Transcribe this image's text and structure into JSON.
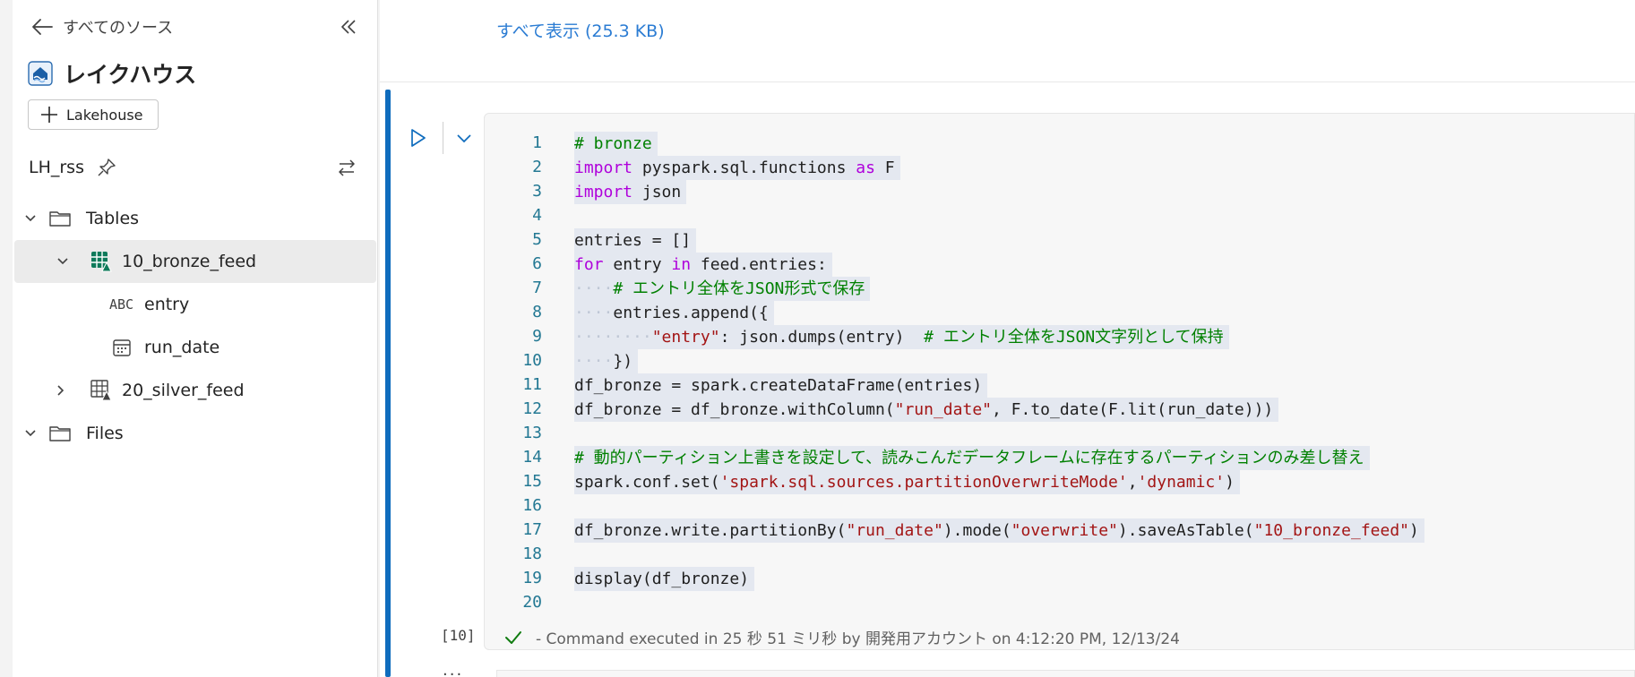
{
  "sidebar": {
    "back_label": "すべてのソース",
    "title": "レイクハウス",
    "add_button_label": "Lakehouse",
    "lakehouse_name": "LH_rss",
    "tree": {
      "tables_label": "Tables",
      "table1": "10_bronze_feed",
      "column1_type": "ABC",
      "column1": "entry",
      "column2": "run_date",
      "table2": "20_silver_feed",
      "files_label": "Files"
    }
  },
  "notebook": {
    "show_all_label": "すべて表示 (25.3 KB)",
    "line_numbers": [
      "1",
      "2",
      "3",
      "4",
      "5",
      "6",
      "7",
      "8",
      "9",
      "10",
      "11",
      "12",
      "13",
      "14",
      "15",
      "16",
      "17",
      "18",
      "19",
      "20"
    ],
    "code": {
      "l1": "# bronze",
      "l2_import": "import",
      "l2_mod": " pyspark.sql.functions ",
      "l2_as": "as",
      "l2_alias": " F",
      "l3_import": "import",
      "l3_mod": " json",
      "l5": "entries = []",
      "l6_for": "for",
      "l6_var": " entry ",
      "l6_in": "in",
      "l6_rest": " feed.entries:",
      "l7_ws": "····",
      "l7_cm": "# エントリ全体をJSON形式で保存",
      "l8_ws": "····",
      "l8_code": "entries.append({",
      "l9_ws": "········",
      "l9_key": "\"entry\"",
      "l9_code": ": json.dumps(entry)  ",
      "l9_cm": "# エントリ全体をJSON文字列として保持",
      "l10_ws": "····",
      "l10_code": "})",
      "l11": "df_bronze = spark.createDataFrame(entries)",
      "l12_a": "df_bronze = df_bronze.withColumn(",
      "l12_str": "\"run_date\"",
      "l12_b": ", F.to_date(F.lit(run_date)))",
      "l14_cm": "# 動的パーティション上書きを設定して、読みこんだデータフレームに存在するパーティションのみ差し替え",
      "l15_a": "spark.conf.set(",
      "l15_str1": "'spark.sql.sources.partitionOverwriteMode'",
      "l15_comma": ",",
      "l15_str2": "'dynamic'",
      "l15_b": ")",
      "l17_a": "df_bronze.write.partitionBy(",
      "l17_str1": "\"run_date\"",
      "l17_b": ").mode(",
      "l17_str2": "\"overwrite\"",
      "l17_c": ").saveAsTable(",
      "l17_str3": "\"10_bronze_feed\"",
      "l17_d": ")",
      "l19": "display(df_bronze)"
    },
    "exec_count": "[10]",
    "exec_status": "- Command executed in 25 秒 51 ミリ秒 by 開発用アカウント on 4:12:20 PM, 12/13/24",
    "more_label": "..."
  },
  "colors": {
    "accent": "#0f6cbd",
    "link": "#2b7cd3",
    "keyword": "#af00db",
    "comment": "#008000",
    "string": "#a31515",
    "line_number": "#237893",
    "success": "#107c10"
  }
}
